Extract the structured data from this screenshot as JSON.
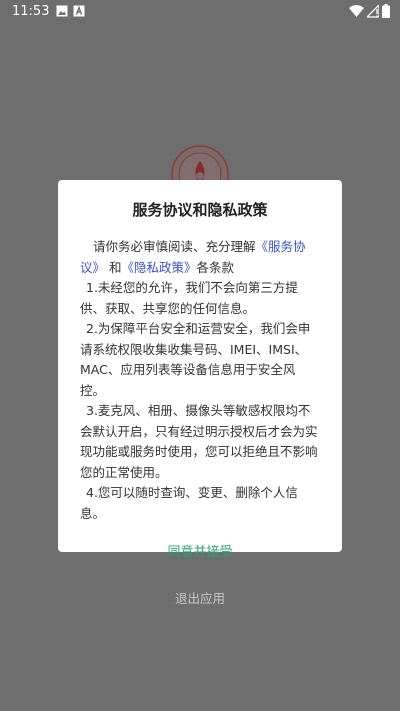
{
  "status_bar": {
    "time": "11:53",
    "icons": [
      "image-icon",
      "text-icon",
      "wifi-icon",
      "signal-icon",
      "battery-icon"
    ]
  },
  "dialog": {
    "title": "服务协议和隐私政策",
    "intro_prefix": "请你务必审慎阅读、充分理解",
    "link_service": "《服务协议》",
    "intro_and": "和",
    "link_privacy": "《隐私政策》",
    "intro_suffix": "各条款",
    "item1": "1.未经您的允许，我们不会向第三方提供、获取、共享您的任何信息。",
    "item2": "2.为保障平台安全和运营安全，我们会申请系统权限收集收集号码、IMEI、IMSI、MAC、应用列表等设备信息用于安全风控。",
    "item3": "3.麦克风、相册、摄像头等敏感权限均不会默认开启，只有经过明示授权后才会为实现功能或服务时使用，您可以拒绝且不影响您的正常使用。",
    "item4": "4.您可以随时查询、变更、删除个人信息。",
    "accept_label": "同意并接受",
    "exit_label": "退出应用"
  },
  "colors": {
    "overlay": "#6e6e6e",
    "link": "#3a53c5",
    "accept": "#28a07a",
    "exit": "#c8c8c8"
  }
}
